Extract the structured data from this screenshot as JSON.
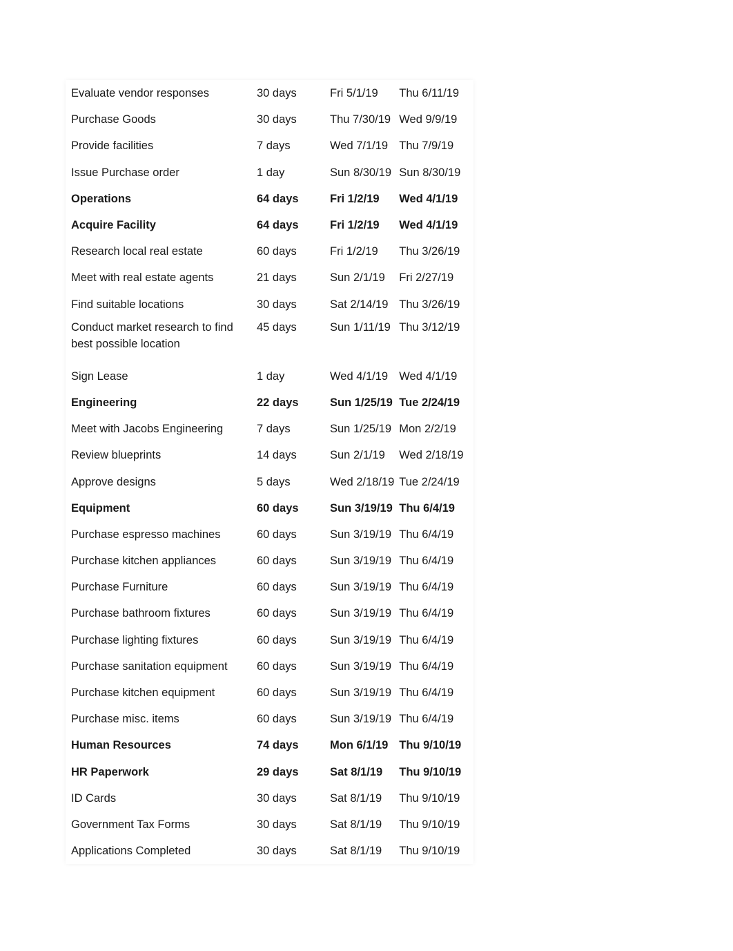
{
  "rows": [
    {
      "task": "Evaluate vendor responses",
      "duration": "30 days",
      "start": "Fri 5/1/19",
      "finish": "Thu 6/11/19",
      "bold": false
    },
    {
      "task": "Purchase Goods",
      "duration": "30 days",
      "start": "Thu 7/30/19",
      "finish": "Wed 9/9/19",
      "bold": false
    },
    {
      "task": "Provide facilities",
      "duration": "7 days",
      "start": "Wed 7/1/19",
      "finish": "Thu 7/9/19",
      "bold": false
    },
    {
      "task": "Issue Purchase order",
      "duration": "1 day",
      "start": "Sun 8/30/19",
      "finish": "Sun 8/30/19",
      "bold": false
    },
    {
      "task": "Operations",
      "duration": "64 days",
      "start": "Fri 1/2/19",
      "finish": "Wed 4/1/19",
      "bold": true
    },
    {
      "task": "Acquire Facility",
      "duration": "64 days",
      "start": "Fri 1/2/19",
      "finish": "Wed 4/1/19",
      "bold": true
    },
    {
      "task": "Research local real estate",
      "duration": "60 days",
      "start": "Fri 1/2/19",
      "finish": "Thu 3/26/19",
      "bold": false
    },
    {
      "task": "Meet with real estate agents",
      "duration": "21 days",
      "start": "Sun 2/1/19",
      "finish": "Fri 2/27/19",
      "bold": false
    },
    {
      "task": "Find suitable locations",
      "duration": "30 days",
      "start": "Sat 2/14/19",
      "finish": "Thu 3/26/19",
      "bold": false
    },
    {
      "task": "Conduct market research to find best possible location",
      "duration": "45 days",
      "start": "Sun 1/11/19",
      "finish": "Thu 3/12/19",
      "bold": false,
      "wrap": true
    },
    {
      "task": "Sign Lease",
      "duration": "1 day",
      "start": "Wed 4/1/19",
      "finish": "Wed 4/1/19",
      "bold": false
    },
    {
      "task": "Engineering",
      "duration": "22 days",
      "start": "Sun 1/25/19",
      "finish": "Tue 2/24/19",
      "bold": true
    },
    {
      "task": "Meet with Jacobs Engineering",
      "duration": "7 days",
      "start": "Sun 1/25/19",
      "finish": "Mon 2/2/19",
      "bold": false
    },
    {
      "task": "Review blueprints",
      "duration": "14 days",
      "start": "Sun 2/1/19",
      "finish": "Wed 2/18/19",
      "bold": false
    },
    {
      "task": "Approve designs",
      "duration": "5 days",
      "start": "Wed 2/18/19",
      "finish": "Tue 2/24/19",
      "bold": false
    },
    {
      "task": "Equipment",
      "duration": "60 days",
      "start": "Sun 3/19/19",
      "finish": "Thu 6/4/19",
      "bold": true
    },
    {
      "task": "Purchase espresso machines",
      "duration": "60 days",
      "start": "Sun 3/19/19",
      "finish": "Thu 6/4/19",
      "bold": false
    },
    {
      "task": "Purchase kitchen appliances",
      "duration": "60 days",
      "start": "Sun 3/19/19",
      "finish": "Thu 6/4/19",
      "bold": false
    },
    {
      "task": "Purchase Furniture",
      "duration": "60 days",
      "start": "Sun 3/19/19",
      "finish": "Thu 6/4/19",
      "bold": false
    },
    {
      "task": "Purchase bathroom fixtures",
      "duration": "60 days",
      "start": "Sun 3/19/19",
      "finish": "Thu 6/4/19",
      "bold": false
    },
    {
      "task": "Purchase lighting fixtures",
      "duration": "60 days",
      "start": "Sun 3/19/19",
      "finish": "Thu 6/4/19",
      "bold": false
    },
    {
      "task": "Purchase sanitation equipment",
      "duration": "60 days",
      "start": "Sun 3/19/19",
      "finish": "Thu 6/4/19",
      "bold": false
    },
    {
      "task": "Purchase kitchen equipment",
      "duration": "60 days",
      "start": "Sun 3/19/19",
      "finish": "Thu 6/4/19",
      "bold": false
    },
    {
      "task": "Purchase misc. items",
      "duration": "60 days",
      "start": "Sun 3/19/19",
      "finish": "Thu 6/4/19",
      "bold": false
    },
    {
      "task": "Human Resources",
      "duration": "74 days",
      "start": "Mon 6/1/19",
      "finish": "Thu 9/10/19",
      "bold": true
    },
    {
      "task": "HR Paperwork",
      "duration": "29 days",
      "start": "Sat 8/1/19",
      "finish": "Thu 9/10/19",
      "bold": true
    },
    {
      "task": "ID Cards",
      "duration": "30 days",
      "start": "Sat 8/1/19",
      "finish": "Thu 9/10/19",
      "bold": false
    },
    {
      "task": "Government Tax Forms",
      "duration": "30 days",
      "start": "Sat 8/1/19",
      "finish": "Thu 9/10/19",
      "bold": false
    },
    {
      "task": "Applications Completed",
      "duration": "30 days",
      "start": "Sat 8/1/19",
      "finish": "Thu 9/10/19",
      "bold": false
    }
  ]
}
